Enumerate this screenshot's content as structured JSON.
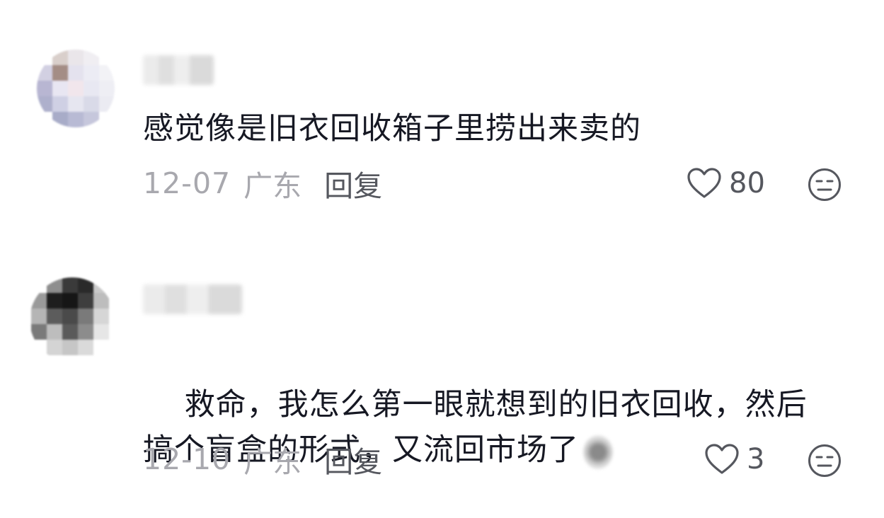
{
  "comments": [
    {
      "text": "感觉像是旧衣回收箱子里捞出来卖的",
      "date": "12-07",
      "location": "广东",
      "reply_label": "回复",
      "like_count": "80"
    },
    {
      "text": "救命，我怎么第一眼就想到的旧衣回收，然后\n搞个盲盒的形式，又流回市场了",
      "date": "12-10",
      "location": "广东",
      "reply_label": "回复",
      "like_count": "3"
    }
  ],
  "icons": {
    "like": "heart-outline-icon",
    "dislike": "neutral-face-icon",
    "emoji": "blurred-emoji-sticker"
  },
  "colors": {
    "text": "#161823",
    "meta": "#a8a8ae",
    "reply": "#55575e",
    "icon": "#55575e"
  }
}
